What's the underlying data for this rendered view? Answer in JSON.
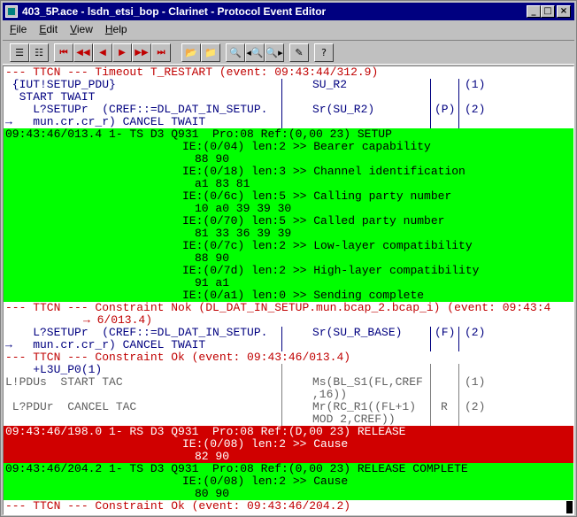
{
  "window": {
    "title": "403_5P.ace - lsdn_etsi_bop - Clarinet - Protocol Event Editor",
    "minimize_glyph": "_",
    "maximize_glyph": "□",
    "close_glyph": "×"
  },
  "menu": [
    {
      "key": "F",
      "rest": "ile"
    },
    {
      "key": "E",
      "rest": "dit"
    },
    {
      "key": "V",
      "rest": "iew"
    },
    {
      "key": "H",
      "rest": "elp"
    }
  ],
  "toolbar": {
    "buttons": [
      {
        "name": "list-view-icon",
        "glyph": "☰"
      },
      {
        "name": "list-detail-icon",
        "glyph": "☷"
      },
      {
        "name": "first-event-icon",
        "glyph": "⏮"
      },
      {
        "name": "rewind-icon",
        "glyph": "◀◀"
      },
      {
        "name": "prev-event-icon",
        "glyph": "◀"
      },
      {
        "name": "next-event-icon",
        "glyph": "▶"
      },
      {
        "name": "fast-forward-icon",
        "glyph": "▶▶"
      },
      {
        "name": "last-event-icon",
        "glyph": "⏭"
      },
      {
        "name": "open-folder-icon",
        "glyph": "📂"
      },
      {
        "name": "save-folder-icon",
        "glyph": "📁"
      },
      {
        "name": "find-icon",
        "glyph": "🔍"
      },
      {
        "name": "find-prev-icon",
        "glyph": "◂🔍"
      },
      {
        "name": "find-next-icon",
        "glyph": "🔍▸"
      },
      {
        "name": "properties-icon",
        "glyph": "✎"
      },
      {
        "name": "context-help-icon",
        "glyph": "?"
      }
    ]
  },
  "log": [
    {
      "name": "ttcn-timeout-line",
      "bg": "",
      "cells": [
        {
          "text": "--- TTCN --- Timeout T_RESTART (event: 09:43:44/312.9)",
          "cls": "red",
          "col": 0
        }
      ]
    },
    {
      "name": "ttcn-table-row",
      "bg": "",
      "cls": "navy",
      "cols": [
        0
      ],
      "lines": [
        314,
        482,
        514
      ],
      "cells": [
        {
          "text": " {IUT!SETUP_PDU}",
          "cls": "navy",
          "col": 0
        },
        {
          "text": "SU_R2",
          "cls": "navy",
          "col": 347
        },
        {
          "text": "(1)",
          "cls": "navy",
          "col": 519
        }
      ]
    },
    {
      "name": "ttcn-table-row",
      "bg": "",
      "lines": [
        314,
        482,
        514
      ],
      "cells": [
        {
          "text": "  START TWAIT",
          "cls": "navy",
          "col": 0
        }
      ]
    },
    {
      "name": "ttcn-table-row",
      "bg": "",
      "lines": [
        314,
        482,
        514
      ],
      "cells": [
        {
          "text": "    L?SETUPr  (CREF::=DL_DAT_IN_SETUP.",
          "cls": "navy",
          "col": 0
        },
        {
          "text": "Sr(SU_R2)",
          "cls": "navy",
          "col": 347
        },
        {
          "text": "(P)",
          "cls": "navy",
          "col": 485
        },
        {
          "text": "(2)",
          "cls": "navy",
          "col": 519
        }
      ]
    },
    {
      "name": "ttcn-table-row",
      "bg": "",
      "lines": [
        314,
        482,
        514
      ],
      "cells": [
        {
          "text": "→   mun.cr.cr_r) CANCEL TWAIT",
          "cls": "navy",
          "col": 0
        }
      ]
    },
    {
      "name": "frame-header-setup",
      "bg": "green",
      "cells": [
        {
          "text": "09:43:46/013.4 1- TS D3 Q931  Pro:08 Ref:(0,00 23) SETUP",
          "cls": "black",
          "col": 0
        }
      ]
    },
    {
      "name": "ie-line",
      "bg": "green",
      "cells": [
        {
          "text": "IE:(0/04) len:2 >> Bearer capability",
          "cls": "black",
          "col": 200
        }
      ]
    },
    {
      "name": "ie-bytes",
      "bg": "green",
      "cells": [
        {
          "text": "88 90",
          "cls": "black",
          "col": 214
        }
      ]
    },
    {
      "name": "ie-line",
      "bg": "green",
      "cells": [
        {
          "text": "IE:(0/18) len:3 >> Channel identification",
          "cls": "black",
          "col": 200
        }
      ]
    },
    {
      "name": "ie-bytes",
      "bg": "green",
      "cells": [
        {
          "text": "a1 83 81",
          "cls": "black",
          "col": 214
        }
      ]
    },
    {
      "name": "ie-line",
      "bg": "green",
      "cells": [
        {
          "text": "IE:(0/6c) len:5 >> Calling party number",
          "cls": "black",
          "col": 200
        }
      ]
    },
    {
      "name": "ie-bytes",
      "bg": "green",
      "cells": [
        {
          "text": "10 a0 39 39 30",
          "cls": "black",
          "col": 214
        }
      ]
    },
    {
      "name": "ie-line",
      "bg": "green",
      "cells": [
        {
          "text": "IE:(0/70) len:5 >> Called party number",
          "cls": "black",
          "col": 200
        }
      ]
    },
    {
      "name": "ie-bytes",
      "bg": "green",
      "cells": [
        {
          "text": "81 33 36 39 39",
          "cls": "black",
          "col": 214
        }
      ]
    },
    {
      "name": "ie-line",
      "bg": "green",
      "cells": [
        {
          "text": "IE:(0/7c) len:2 >> Low-layer compatibility",
          "cls": "black",
          "col": 200
        }
      ]
    },
    {
      "name": "ie-bytes",
      "bg": "green",
      "cells": [
        {
          "text": "88 90",
          "cls": "black",
          "col": 214
        }
      ]
    },
    {
      "name": "ie-line",
      "bg": "green",
      "cells": [
        {
          "text": "IE:(0/7d) len:2 >> High-layer compatibility",
          "cls": "black",
          "col": 200
        }
      ]
    },
    {
      "name": "ie-bytes",
      "bg": "green",
      "cells": [
        {
          "text": "91 a1",
          "cls": "black",
          "col": 214
        }
      ]
    },
    {
      "name": "ie-line",
      "bg": "green",
      "cells": [
        {
          "text": "IE:(0/a1) len:0 >> Sending complete",
          "cls": "black",
          "col": 200
        }
      ]
    },
    {
      "name": "ttcn-constraint-nok-line",
      "bg": "",
      "cells": [
        {
          "text": "--- TTCN --- Constraint Nok (DL_DAT_IN_SETUP.mun.bcap_2.bcap_i) (event: 09:43:4",
          "cls": "red",
          "col": 0
        }
      ]
    },
    {
      "name": "ttcn-constraint-nok-cont",
      "bg": "",
      "cells": [
        {
          "text": "→ 6/013.4)",
          "cls": "red",
          "col": 88
        }
      ]
    },
    {
      "name": "ttcn-table-row",
      "bg": "",
      "lines": [
        314,
        482,
        514
      ],
      "cells": [
        {
          "text": "    L?SETUPr  (CREF::=DL_DAT_IN_SETUP.",
          "cls": "navy",
          "col": 0
        },
        {
          "text": "Sr(SU_R_BASE)",
          "cls": "navy",
          "col": 347
        },
        {
          "text": "(F)",
          "cls": "navy",
          "col": 485
        },
        {
          "text": "(2)",
          "cls": "navy",
          "col": 519
        }
      ]
    },
    {
      "name": "ttcn-table-row",
      "bg": "",
      "lines": [
        314,
        482,
        514
      ],
      "cells": [
        {
          "text": "→   mun.cr.cr_r) CANCEL TWAIT",
          "cls": "navy",
          "col": 0
        }
      ]
    },
    {
      "name": "ttcn-constraint-ok-line",
      "bg": "",
      "cells": [
        {
          "text": "--- TTCN --- Constraint Ok (event: 09:43:46/013.4)",
          "cls": "red",
          "col": 0
        }
      ]
    },
    {
      "name": "ttcn-table-row",
      "bg": "",
      "glines": [
        314,
        482,
        514
      ],
      "cells": [
        {
          "text": "    +L3U_P0(1)",
          "cls": "navy",
          "col": 0
        }
      ]
    },
    {
      "name": "ttcn-table-row",
      "bg": "",
      "glines": [
        314,
        482,
        514
      ],
      "cells": [
        {
          "text": "L!PDUs  START TAC",
          "cls": "gray",
          "col": 0
        },
        {
          "text": "Ms(BL_S1(FL,CREF",
          "cls": "gray",
          "col": 347
        },
        {
          "text": "(1)",
          "cls": "gray",
          "col": 519
        }
      ]
    },
    {
      "name": "ttcn-table-row",
      "bg": "",
      "glines": [
        314,
        482,
        514
      ],
      "cells": [
        {
          "text": ",16))",
          "cls": "gray",
          "col": 347
        }
      ]
    },
    {
      "name": "ttcn-table-row",
      "bg": "",
      "glines": [
        314,
        482,
        514
      ],
      "cells": [
        {
          "text": " L?PDUr  CANCEL TAC",
          "cls": "gray",
          "col": 0
        },
        {
          "text": "Mr(RC_R1((FL+1)",
          "cls": "gray",
          "col": 347
        },
        {
          "text": "R",
          "cls": "gray",
          "col": 492
        },
        {
          "text": "(2)",
          "cls": "gray",
          "col": 519
        }
      ]
    },
    {
      "name": "ttcn-table-row",
      "bg": "",
      "glines": [
        314,
        482,
        514
      ],
      "cells": [
        {
          "text": "MOD 2,CREF))",
          "cls": "gray",
          "col": 347
        }
      ]
    },
    {
      "name": "frame-header-release",
      "bg": "red",
      "cells": [
        {
          "text": "09:43:46/198.0 1- RS D3 Q931  Pro:08 Ref:(D,00 23) RELEASE",
          "cls": "black",
          "col": 0
        }
      ]
    },
    {
      "name": "ie-line",
      "bg": "red",
      "cells": [
        {
          "text": "IE:(0/08) len:2 >> Cause",
          "cls": "black",
          "col": 200
        }
      ]
    },
    {
      "name": "ie-bytes",
      "bg": "red",
      "cells": [
        {
          "text": "82 90",
          "cls": "black",
          "col": 214
        }
      ]
    },
    {
      "name": "frame-header-release-complete",
      "bg": "green",
      "cells": [
        {
          "text": "09:43:46/204.2 1- TS D3 Q931  Pro:08 Ref:(0,00 23) RELEASE COMPLETE",
          "cls": "black",
          "col": 0
        }
      ]
    },
    {
      "name": "ie-line",
      "bg": "green",
      "cells": [
        {
          "text": "IE:(0/08) len:2 >> Cause",
          "cls": "black",
          "col": 200
        }
      ]
    },
    {
      "name": "ie-bytes",
      "bg": "green",
      "cells": [
        {
          "text": "80 90",
          "cls": "black",
          "col": 214
        }
      ]
    },
    {
      "name": "ttcn-constraint-ok-line",
      "bg": "",
      "cells": [
        {
          "text": "--- TTCN --- Constraint Ok (event: 09:43:46/204.2)",
          "cls": "red",
          "col": 0
        }
      ]
    }
  ]
}
